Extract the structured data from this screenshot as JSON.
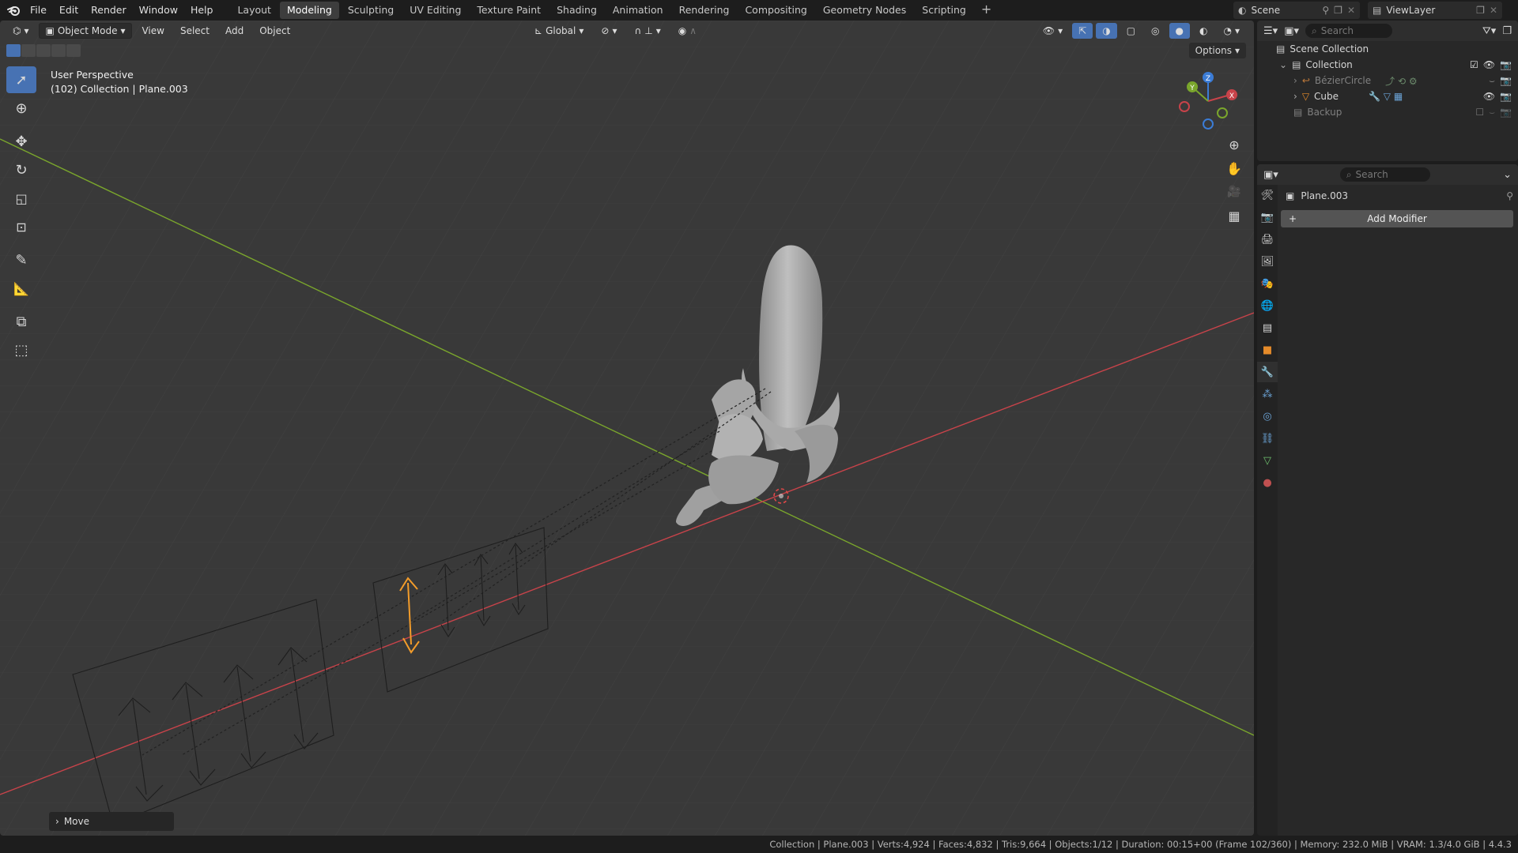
{
  "menu": [
    "File",
    "Edit",
    "Render",
    "Window",
    "Help"
  ],
  "workspaces": [
    "Layout",
    "Modeling",
    "Sculpting",
    "UV Editing",
    "Texture Paint",
    "Shading",
    "Animation",
    "Rendering",
    "Compositing",
    "Geometry Nodes",
    "Scripting"
  ],
  "active_workspace": "Modeling",
  "scene_name": "Scene",
  "view_layer": "ViewLayer",
  "viewport": {
    "mode": "Object Mode",
    "menus": [
      "View",
      "Select",
      "Add",
      "Object"
    ],
    "transform_orientation": "Global",
    "info_line1": "User Perspective",
    "info_line2": "(102) Collection | Plane.003",
    "options_label": "Options",
    "last_operator": "Move",
    "gizmo_axes": {
      "x": "X",
      "y": "Y",
      "z": "Z"
    }
  },
  "outliner": {
    "search_placeholder": "Search",
    "root": "Scene Collection",
    "collection": "Collection",
    "items": [
      {
        "name": "BézierCircle",
        "dim": true
      },
      {
        "name": "Cube",
        "dim": false
      }
    ],
    "backup": "Backup"
  },
  "properties": {
    "search_placeholder": "Search",
    "object_name": "Plane.003",
    "add_modifier_label": "Add Modifier"
  },
  "status_bar": "Collection | Plane.003 | Verts:4,924 | Faces:4,832 | Tris:9,664 | Objects:1/12 | Duration: 00:15+00 (Frame 102/360) | Memory: 232.0 MiB | VRAM: 1.3/4.0 GiB | 4.4.3",
  "colors": {
    "accent": "#4772b3",
    "selection": "#f0a040",
    "x_axis": "#c8434a",
    "y_axis": "#7aa62c",
    "z_axis": "#3b7cd6"
  }
}
